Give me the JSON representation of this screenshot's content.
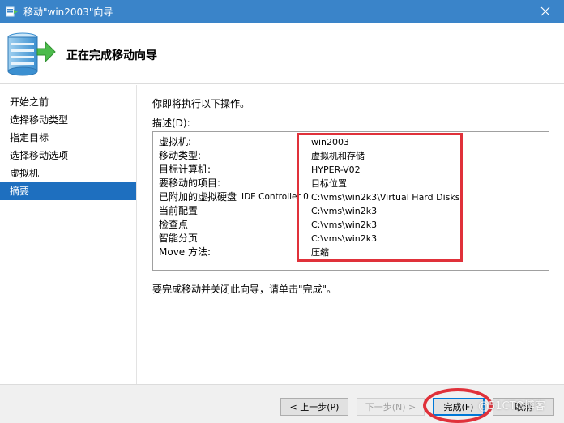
{
  "window": {
    "title": "移动\"win2003\"向导"
  },
  "header": {
    "title": "正在完成移动向导"
  },
  "sidebar": {
    "items": [
      {
        "label": "开始之前"
      },
      {
        "label": "选择移动类型"
      },
      {
        "label": "指定目标"
      },
      {
        "label": "选择移动选项"
      },
      {
        "label": "虚拟机"
      },
      {
        "label": "摘要",
        "active": true
      }
    ]
  },
  "main": {
    "intro": "你即将执行以下操作。",
    "description_label": "描述(D):",
    "rows": [
      {
        "key": "虚拟机:",
        "sub": "",
        "value": "win2003"
      },
      {
        "key": "移动类型:",
        "sub": "",
        "value": "虚拟机和存储"
      },
      {
        "key": "目标计算机:",
        "sub": "",
        "value": "HYPER-V02"
      },
      {
        "key": "要移动的项目:",
        "sub": "",
        "value": "目标位置"
      },
      {
        "key": "已附加的虚拟硬盘",
        "sub": "IDE Controller 0",
        "value": "C:\\vms\\win2k3\\Virtual Hard Disks"
      },
      {
        "key": "当前配置",
        "sub": "",
        "value": "C:\\vms\\win2k3"
      },
      {
        "key": "检查点",
        "sub": "",
        "value": "C:\\vms\\win2k3"
      },
      {
        "key": "智能分页",
        "sub": "",
        "value": "C:\\vms\\win2k3"
      },
      {
        "key": "Move 方法:",
        "sub": "",
        "value": "压缩"
      }
    ],
    "finish_note": "要完成移动并关闭此向导，请单击\"完成\"。"
  },
  "footer": {
    "prev_label": "< 上一步(P)",
    "next_label": "下一步(N) >",
    "finish_label": "完成(F)",
    "cancel_label": "取消"
  },
  "watermark": "@51CTO博客",
  "colors": {
    "titlebar": "#3a84c9",
    "selected": "#1e6fbf",
    "highlight": "#e0313a"
  }
}
